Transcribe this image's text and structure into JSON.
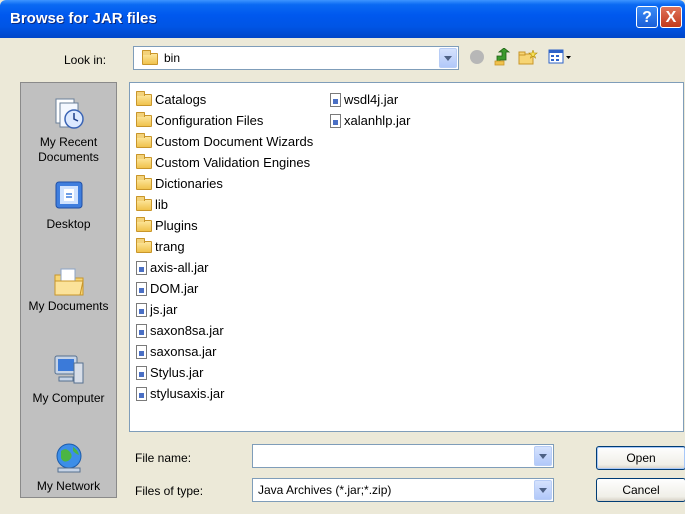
{
  "window": {
    "title": "Browse for JAR files",
    "help_glyph": "?",
    "close_glyph": "X"
  },
  "lookin": {
    "label": "Look in:",
    "value": "bin"
  },
  "toolbar": {
    "icons": [
      "back-icon",
      "up-folder-icon",
      "new-folder-icon",
      "views-menu-icon"
    ]
  },
  "places": [
    {
      "label": "My Recent Documents",
      "icon": "recent-documents-icon"
    },
    {
      "label": "Desktop",
      "icon": "desktop-icon"
    },
    {
      "label": "My Documents",
      "icon": "my-documents-icon"
    },
    {
      "label": "My Computer",
      "icon": "my-computer-icon"
    },
    {
      "label": "My Network",
      "icon": "my-network-icon"
    }
  ],
  "files": {
    "column1": [
      {
        "name": "Catalogs",
        "type": "folder"
      },
      {
        "name": "Configuration Files",
        "type": "folder"
      },
      {
        "name": "Custom Document Wizards",
        "type": "folder"
      },
      {
        "name": "Custom Validation Engines",
        "type": "folder"
      },
      {
        "name": "Dictionaries",
        "type": "folder"
      },
      {
        "name": "lib",
        "type": "folder"
      },
      {
        "name": "Plugins",
        "type": "folder"
      },
      {
        "name": "trang",
        "type": "folder"
      },
      {
        "name": "axis-all.jar",
        "type": "jar"
      },
      {
        "name": "DOM.jar",
        "type": "jar"
      },
      {
        "name": "js.jar",
        "type": "jar"
      },
      {
        "name": "saxon8sa.jar",
        "type": "jar"
      },
      {
        "name": "saxonsa.jar",
        "type": "jar"
      },
      {
        "name": "Stylus.jar",
        "type": "jar"
      },
      {
        "name": "stylusaxis.jar",
        "type": "jar"
      }
    ],
    "column2": [
      {
        "name": "wsdl4j.jar",
        "type": "jar"
      },
      {
        "name": "xalanhlp.jar",
        "type": "jar"
      }
    ]
  },
  "filename": {
    "label": "File name:",
    "value": ""
  },
  "filetype": {
    "label": "Files of type:",
    "value": "Java Archives (*.jar;*.zip)"
  },
  "buttons": {
    "open": "Open",
    "cancel": "Cancel"
  }
}
